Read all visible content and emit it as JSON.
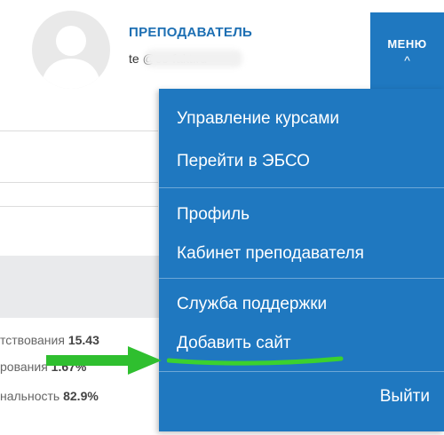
{
  "header": {
    "role": "ПРЕПОДАВАТЕЛЬ",
    "email": "te              @co-fakt.ru"
  },
  "menu_button": {
    "label": "МЕНЮ",
    "chevron": "^"
  },
  "dropdown": {
    "items": [
      {
        "label": "Управление курсами"
      },
      {
        "label": "Перейти в ЭБСО"
      },
      {
        "label": "Профиль"
      },
      {
        "label": "Кабинет преподавателя"
      },
      {
        "label": "Служба поддержки"
      },
      {
        "label": "Добавить сайт"
      }
    ],
    "logout": "Выйти"
  },
  "stats": [
    {
      "label": "тствования",
      "value": "15.43"
    },
    {
      "label": "рования",
      "value": "1.67%"
    },
    {
      "label": "нальность",
      "value": "82.9%"
    }
  ],
  "colors": {
    "accent": "#1f78c0",
    "role_text": "#1d6fb3",
    "highlight": "#2fbf2f"
  },
  "icons": {
    "avatar": "user-silhouette-icon",
    "chevron": "chevron-up-icon"
  }
}
